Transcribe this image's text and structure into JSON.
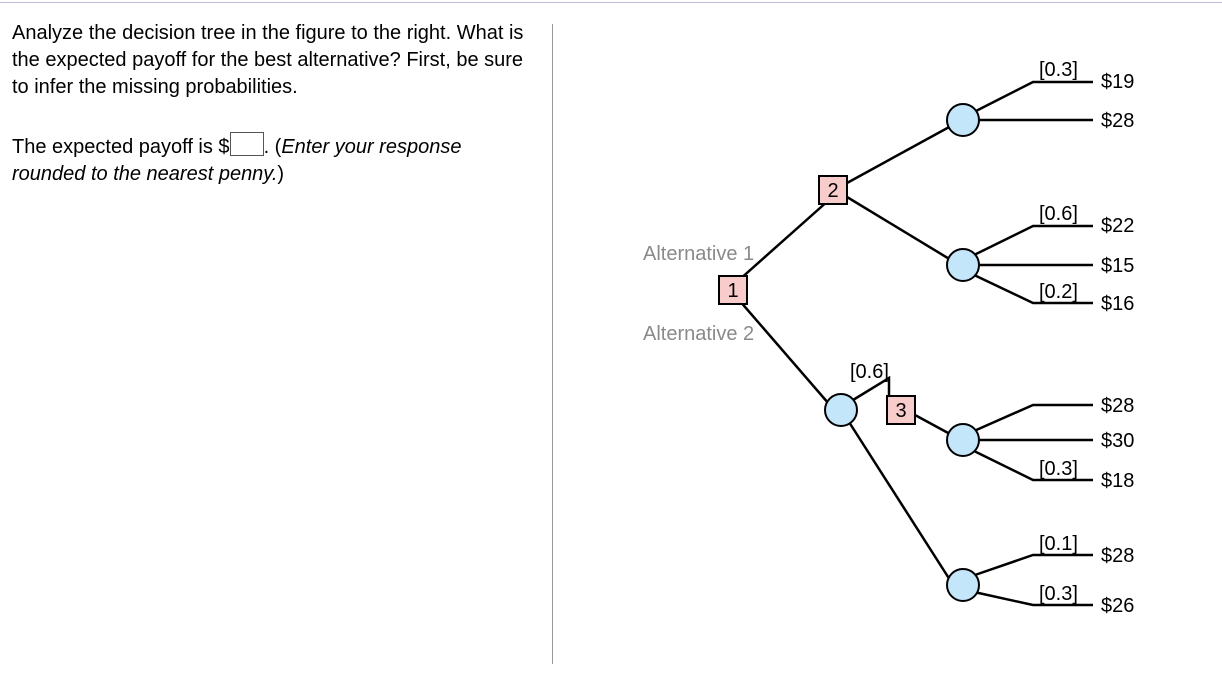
{
  "question": {
    "prompt": "Analyze the decision tree in the figure to the right. What is the expected payoff for the best alternative? First, be sure to infer the missing probabilities.",
    "answer_lead": "The expected payoff is $",
    "answer_tail": ". (",
    "hint": "Enter your response rounded to the nearest penny.",
    "close": ")"
  },
  "tree": {
    "alt1_label": "Alternative 1",
    "alt2_label": "Alternative 2",
    "node1": "1",
    "node2": "2",
    "node3": "3",
    "probs": {
      "c2a_1": "[0.3]",
      "c2b_1": "[0.6]",
      "c2b_3": "[0.2]",
      "alt2_top": "[0.6]",
      "c3a_3": "[0.3]",
      "cBot_1": "[0.1]",
      "cBot_2": "[0.3]"
    },
    "payoffs": {
      "c2a_1": "$19",
      "c2a_2": "$28",
      "c2b_1": "$22",
      "c2b_2": "$15",
      "c2b_3": "$16",
      "c3a_1": "$28",
      "c3a_2": "$30",
      "c3a_3": "$18",
      "cBot_1": "$28",
      "cBot_2": "$26"
    }
  },
  "chart_data": {
    "type": "decision_tree",
    "root": {
      "kind": "decision",
      "id": 1,
      "branches": [
        {
          "label": "Alternative 1",
          "to": {
            "kind": "decision",
            "id": 2,
            "branches": [
              {
                "to": {
                  "kind": "chance",
                  "outcomes": [
                    {
                      "prob": 0.3,
                      "payoff": 19
                    },
                    {
                      "prob": null,
                      "payoff": 28
                    }
                  ]
                }
              },
              {
                "to": {
                  "kind": "chance",
                  "outcomes": [
                    {
                      "prob": 0.6,
                      "payoff": 22
                    },
                    {
                      "prob": null,
                      "payoff": 15
                    },
                    {
                      "prob": 0.2,
                      "payoff": 16
                    }
                  ]
                }
              }
            ]
          }
        },
        {
          "label": "Alternative 2",
          "to": {
            "kind": "chance",
            "outcomes": [
              {
                "prob": 0.6,
                "to": {
                  "kind": "decision",
                  "id": 3,
                  "branches": [
                    {
                      "to": {
                        "kind": "chance",
                        "outcomes": [
                          {
                            "prob": null,
                            "payoff": 28
                          },
                          {
                            "prob": null,
                            "payoff": 30
                          },
                          {
                            "prob": 0.3,
                            "payoff": 18
                          }
                        ]
                      }
                    }
                  ]
                }
              },
              {
                "prob": null,
                "to": {
                  "kind": "chance",
                  "outcomes": [
                    {
                      "prob": 0.1,
                      "payoff": 28
                    },
                    {
                      "prob": 0.3,
                      "payoff": 26
                    }
                  ]
                }
              }
            ]
          }
        }
      ]
    }
  }
}
